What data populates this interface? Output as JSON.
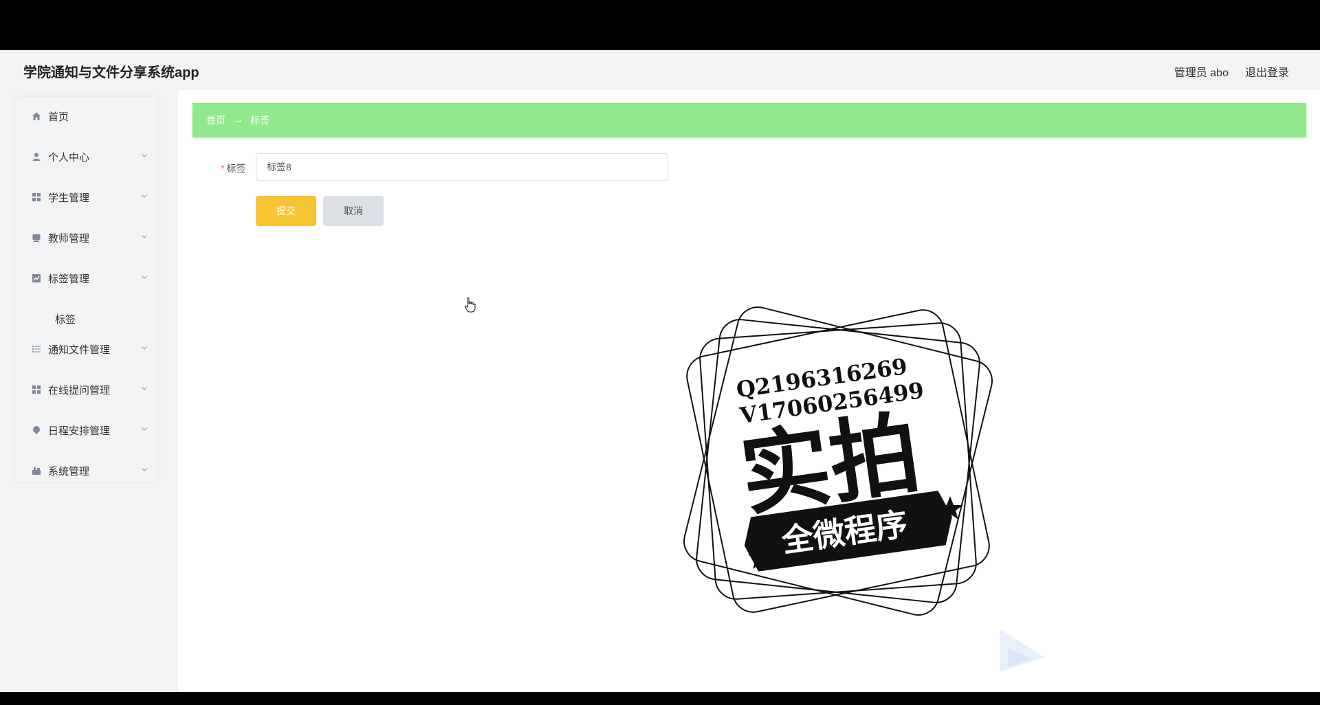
{
  "app": {
    "title": "学院通知与文件分享系统app"
  },
  "header": {
    "user": "管理员 abo",
    "logout": "退出登录"
  },
  "sidebar": {
    "items": [
      {
        "label": "首页",
        "icon": "home-icon"
      },
      {
        "label": "个人中心",
        "icon": "user-icon"
      },
      {
        "label": "学生管理",
        "icon": "grid-icon"
      },
      {
        "label": "教师管理",
        "icon": "teacher-icon"
      },
      {
        "label": "标签管理",
        "icon": "chart-icon"
      },
      {
        "label": "通知文件管理",
        "icon": "list-icon"
      },
      {
        "label": "在线提问管理",
        "icon": "grid-icon"
      },
      {
        "label": "日程安排管理",
        "icon": "pin-icon"
      },
      {
        "label": "系统管理",
        "icon": "settings-icon"
      }
    ],
    "subitem": "标签"
  },
  "breadcrumb": {
    "home": "首页",
    "arrow": "→",
    "current": "标签"
  },
  "form": {
    "label": "标签",
    "required_mark": "*",
    "value": "标签8",
    "submit": "提交",
    "cancel": "取消"
  },
  "watermark": {
    "qq": "Q2196316269",
    "wechat": "V17060256499",
    "big_text": "实拍",
    "ribbon": "全微程序"
  },
  "colors": {
    "breadcrumb_bg": "#90ea8c",
    "submit_bg": "#f7c433",
    "cancel_bg": "#dcdfe6",
    "sidebar_bg": "#f2f3f5"
  }
}
